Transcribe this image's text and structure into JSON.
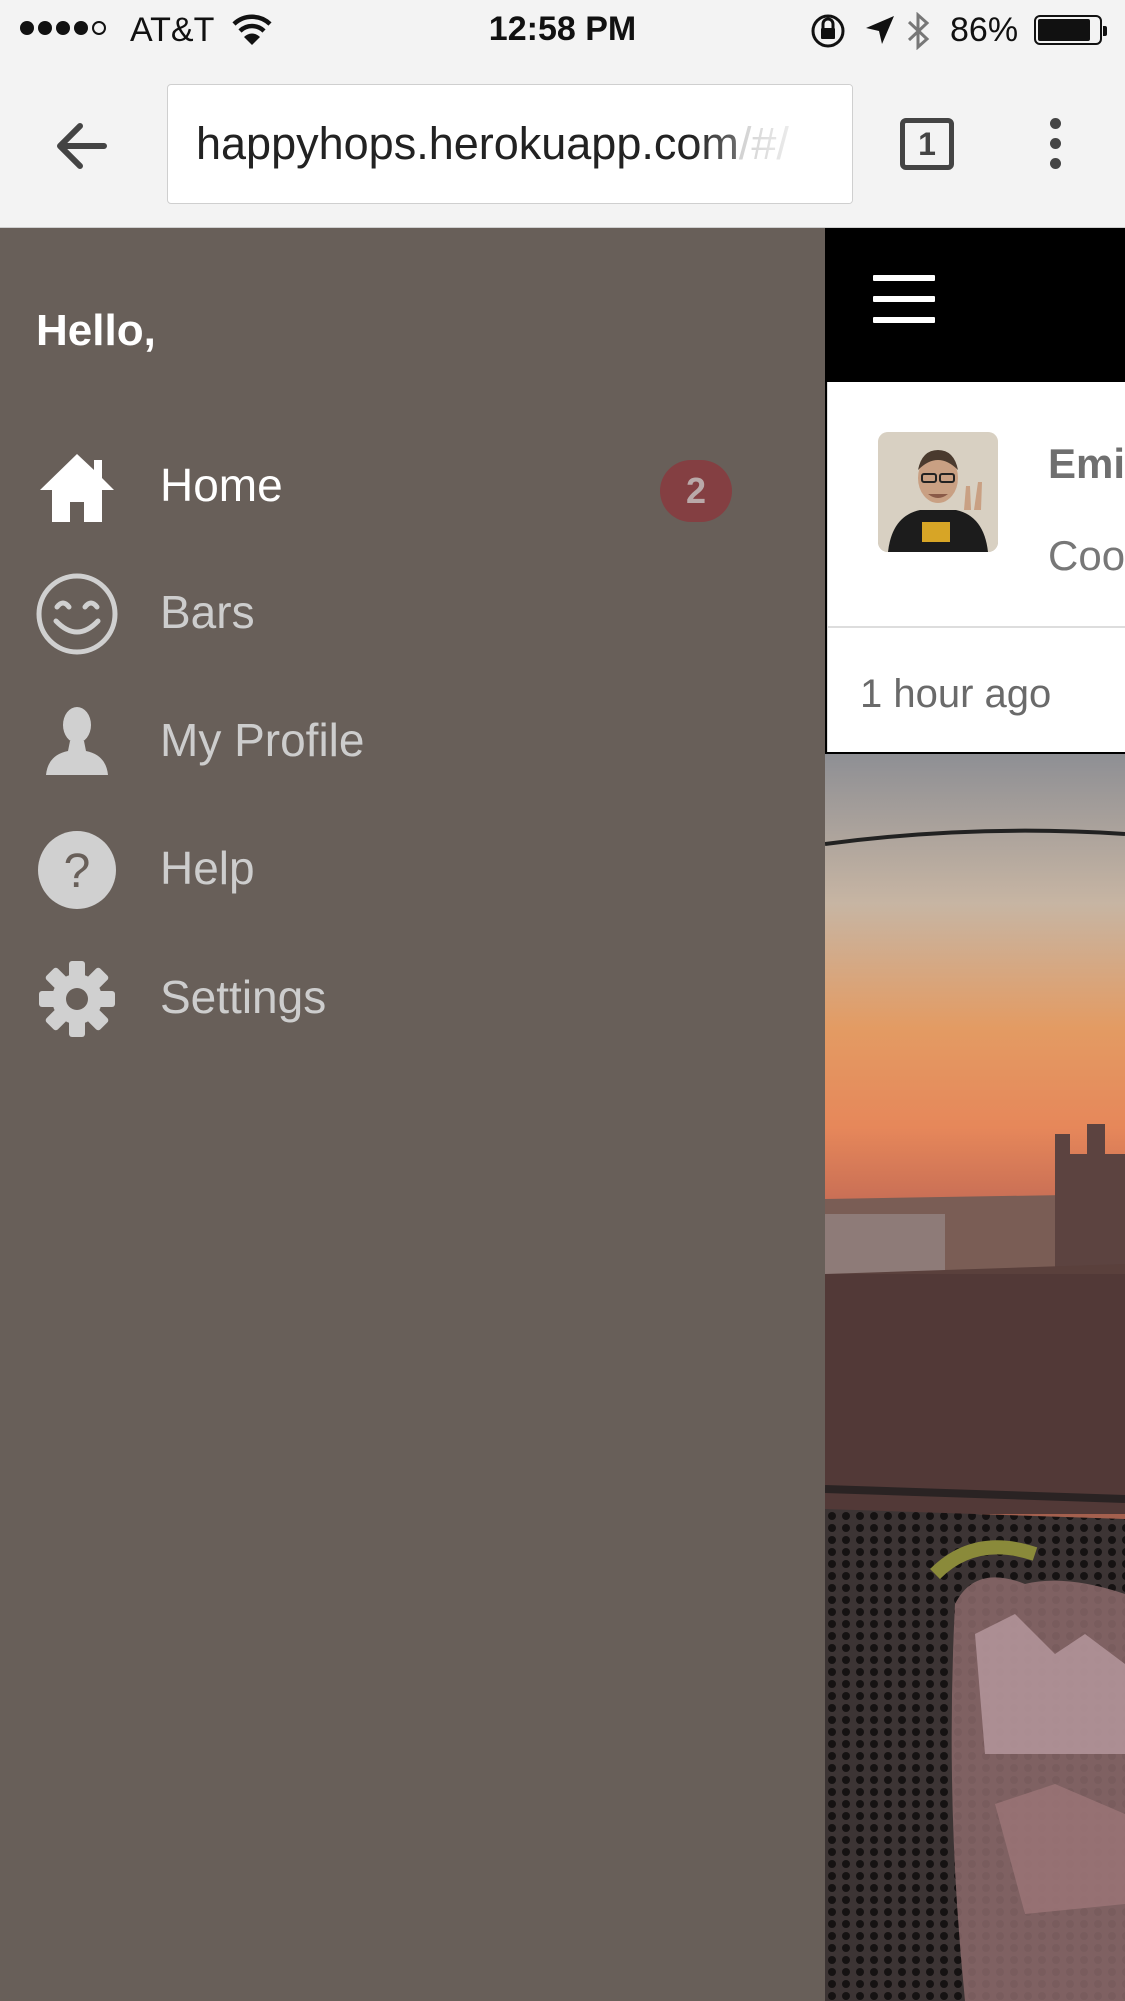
{
  "status_bar": {
    "carrier": "AT&T",
    "time": "12:58 PM",
    "battery_percent": "86%",
    "battery_level": 0.86,
    "icons": [
      "signal-dots-icon",
      "wifi-icon",
      "rotation-lock-icon",
      "location-arrow-icon",
      "bluetooth-icon",
      "battery-icon"
    ]
  },
  "browser": {
    "url_main": "happyhops.herokuapp.com",
    "url_faded": "/#/",
    "tab_count": "1",
    "icons": [
      "back-arrow-icon",
      "tabs-icon",
      "overflow-menu-icon"
    ]
  },
  "drawer": {
    "greeting": "Hello,",
    "items": [
      {
        "label": "Home",
        "icon": "home-icon",
        "active": true,
        "badge": "2"
      },
      {
        "label": "Bars",
        "icon": "smiley-icon",
        "active": false
      },
      {
        "label": "My Profile",
        "icon": "person-icon",
        "active": false
      },
      {
        "label": "Help",
        "icon": "help-icon",
        "active": false
      },
      {
        "label": "Settings",
        "icon": "gear-icon",
        "active": false
      }
    ],
    "colors": {
      "background": "#685f59",
      "badge": "#843f42"
    }
  },
  "feed": {
    "header_icon": "hamburger-icon",
    "post": {
      "author": "Emil",
      "text": "Coo",
      "time": "1 hour ago"
    }
  }
}
